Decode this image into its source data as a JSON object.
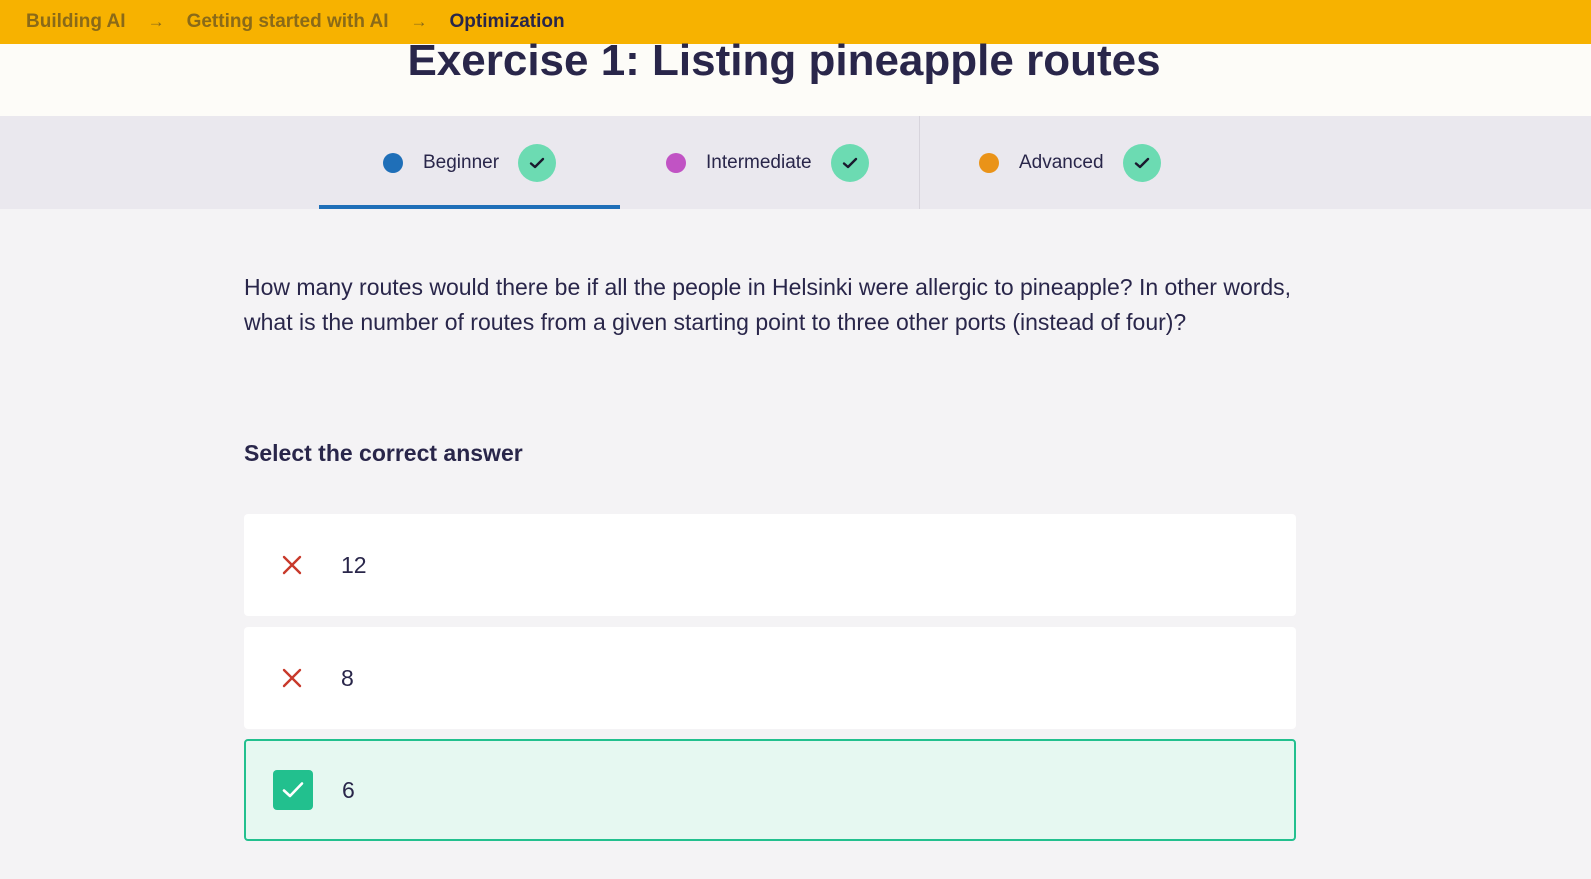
{
  "breadcrumb": {
    "items": [
      "Building AI",
      "Getting started with AI",
      "Optimization"
    ],
    "separator": "→"
  },
  "page": {
    "title": "Exercise 1: Listing pineapple routes"
  },
  "tabs": [
    {
      "label": "Beginner",
      "dot_color": "#1f6fb8",
      "completed": true,
      "active": true
    },
    {
      "label": "Intermediate",
      "dot_color": "#c153c4",
      "completed": true,
      "active": false
    },
    {
      "label": "Advanced",
      "dot_color": "#ea9318",
      "completed": true,
      "active": false
    }
  ],
  "question": {
    "text": "How many routes would there be if all the people in Helsinki were allergic to pineapple? In other words, what is the number of routes from a given starting point to three other ports (instead of four)?"
  },
  "answers": {
    "heading": "Select the correct answer",
    "options": [
      {
        "value": "12",
        "state": "incorrect"
      },
      {
        "value": "8",
        "state": "incorrect"
      },
      {
        "value": "6",
        "state": "correct"
      }
    ]
  },
  "colors": {
    "topbar": "#f7b200",
    "check_badge": "#6cdbb2",
    "correct_accent": "#22c08e",
    "incorrect_mark": "#c8392b",
    "active_tab_underline": "#1f6fb8"
  }
}
